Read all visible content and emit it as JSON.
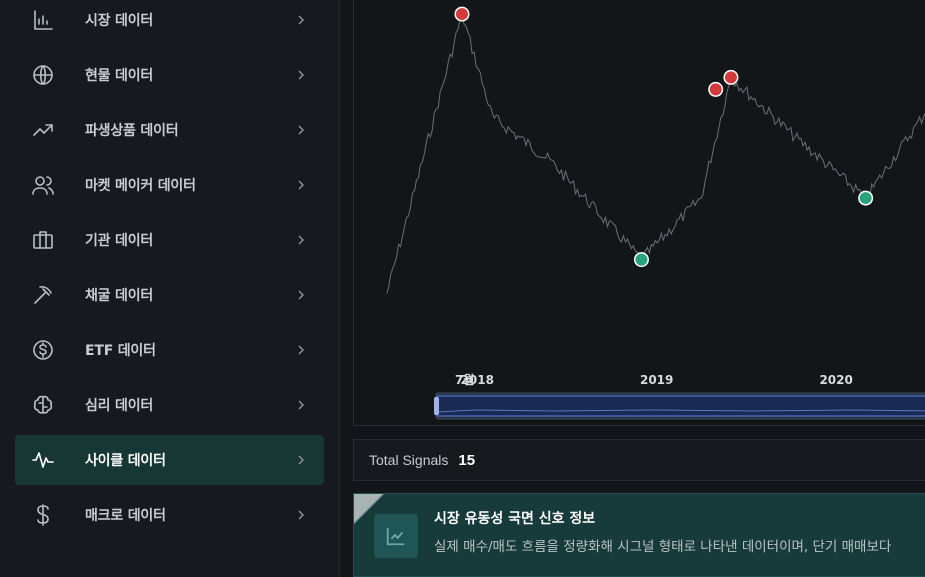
{
  "sidebar": {
    "items": [
      {
        "label": "시장 데이터",
        "icon": "bar-chart-icon",
        "active": false
      },
      {
        "label": "현물 데이터",
        "icon": "globe-icon",
        "active": false
      },
      {
        "label": "파생상품 데이터",
        "icon": "trending-up-icon",
        "active": false
      },
      {
        "label": "마켓 메이커 데이터",
        "icon": "users-icon",
        "active": false
      },
      {
        "label": "기관 데이터",
        "icon": "briefcase-icon",
        "active": false
      },
      {
        "label": "채굴 데이터",
        "icon": "pickaxe-icon",
        "active": false
      },
      {
        "label": "ETF 데이터",
        "icon": "dollar-circle-icon",
        "active": false
      },
      {
        "label": "심리 데이터",
        "icon": "brain-icon",
        "active": false
      },
      {
        "label": "사이클 데이터",
        "icon": "pulse-icon",
        "active": true
      },
      {
        "label": "매크로 데이터",
        "icon": "dollar-sign-icon",
        "active": false
      }
    ]
  },
  "chart": {
    "x_labels": [
      "7월",
      "2018",
      "2019",
      "2020"
    ],
    "colors": {
      "line": "#6b6f74",
      "sell": "#d33a3a",
      "buy": "#27a47a",
      "navigator": "#4a6fd0"
    }
  },
  "chart_data": {
    "type": "line",
    "x": [
      "2017-07",
      "2017-12",
      "2018-02",
      "2018-06",
      "2018-12",
      "2019-04",
      "2019-06",
      "2019-10",
      "2020-03",
      "2020-07"
    ],
    "series": [
      {
        "values": [
          2500,
          19000,
          9000,
          6500,
          3200,
          5000,
          12000,
          8000,
          5000,
          9300
        ]
      }
    ],
    "signals": [
      {
        "date": "2017-12",
        "kind": "sell"
      },
      {
        "date": "2018-12",
        "kind": "buy"
      },
      {
        "date": "2019-05",
        "kind": "sell"
      },
      {
        "date": "2019-06",
        "kind": "sell"
      },
      {
        "date": "2020-03",
        "kind": "buy"
      }
    ]
  },
  "summary": {
    "label": "Total Signals",
    "count": "15"
  },
  "info": {
    "title": "시장 유동성 국면 신호 정보",
    "description": "실제 매수/매도 흐름을 정량화해 시그널 형태로 나타낸 데이터이며, 단기 매매보다"
  }
}
